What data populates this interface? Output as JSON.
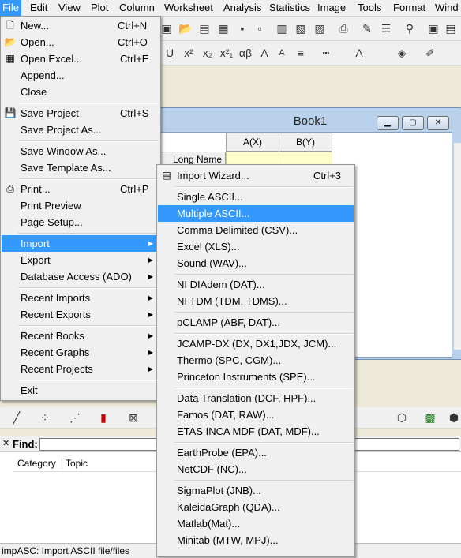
{
  "menubar": {
    "items": [
      "File",
      "Edit",
      "View",
      "Plot",
      "Column",
      "Worksheet",
      "Analysis",
      "Statistics",
      "Image",
      "Tools",
      "Format",
      "Wind"
    ]
  },
  "format_toolbar": {
    "superscript": "x²",
    "subscript": "x₂",
    "supsub": "x²₁",
    "greek": "αβ",
    "grow_font": "A",
    "shrink_font": "A"
  },
  "book": {
    "title": "Book1",
    "col_a": "A(X)",
    "col_b": "B(Y)",
    "row_long_name": "Long Name"
  },
  "file_menu": {
    "items": [
      {
        "label": "New...",
        "shortcut": "Ctrl+N",
        "icon": "new-icon"
      },
      {
        "label": "Open...",
        "shortcut": "Ctrl+O",
        "icon": "open-folder-icon"
      },
      {
        "label": "Open Excel...",
        "shortcut": "Ctrl+E",
        "icon": "excel-icon"
      },
      {
        "label": "Append...",
        "shortcut": ""
      },
      {
        "label": "Close",
        "shortcut": ""
      },
      {
        "label": "Save Project",
        "shortcut": "Ctrl+S",
        "icon": "save-icon"
      },
      {
        "label": "Save Project As...",
        "shortcut": ""
      },
      {
        "label": "Save Window As...",
        "shortcut": ""
      },
      {
        "label": "Save Template As...",
        "shortcut": ""
      },
      {
        "label": "Print...",
        "shortcut": "Ctrl+P",
        "icon": "print-icon"
      },
      {
        "label": "Print Preview",
        "shortcut": ""
      },
      {
        "label": "Page Setup...",
        "shortcut": ""
      },
      {
        "label": "Import",
        "shortcut": "",
        "submenu": true
      },
      {
        "label": "Export",
        "shortcut": "",
        "submenu": true
      },
      {
        "label": "Database Access (ADO)",
        "shortcut": "",
        "submenu": true
      },
      {
        "label": "Recent Imports",
        "shortcut": "",
        "submenu": true
      },
      {
        "label": "Recent Exports",
        "shortcut": "",
        "submenu": true
      },
      {
        "label": "Recent Books",
        "shortcut": "",
        "submenu": true
      },
      {
        "label": "Recent Graphs",
        "shortcut": "",
        "submenu": true
      },
      {
        "label": "Recent Projects",
        "shortcut": "",
        "submenu": true
      },
      {
        "label": "Exit",
        "shortcut": ""
      }
    ]
  },
  "import_menu": {
    "items": [
      {
        "label": "Import Wizard...",
        "shortcut": "Ctrl+3",
        "icon": "import-wizard-icon"
      },
      {
        "label": "Single ASCII..."
      },
      {
        "label": "Multiple ASCII..."
      },
      {
        "label": "Comma Delimited (CSV)..."
      },
      {
        "label": "Excel (XLS)..."
      },
      {
        "label": "Sound (WAV)..."
      },
      {
        "label": "NI DIAdem (DAT)..."
      },
      {
        "label": "NI TDM (TDM, TDMS)..."
      },
      {
        "label": "pCLAMP (ABF, DAT)..."
      },
      {
        "label": "JCAMP-DX (DX, DX1,JDX, JCM)..."
      },
      {
        "label": "Thermo (SPC, CGM)..."
      },
      {
        "label": "Princeton Instruments (SPE)..."
      },
      {
        "label": "Data Translation (DCF, HPF)..."
      },
      {
        "label": "Famos (DAT, RAW)..."
      },
      {
        "label": "ETAS INCA MDF (DAT, MDF)..."
      },
      {
        "label": "EarthProbe (EPA)..."
      },
      {
        "label": "NetCDF (NC)..."
      },
      {
        "label": "SigmaPlot (JNB)..."
      },
      {
        "label": "KaleidaGraph (QDA)..."
      },
      {
        "label": "Matlab(Mat)..."
      },
      {
        "label": "Minitab (MTW, MPJ)..."
      }
    ]
  },
  "find": {
    "label": "Find:"
  },
  "panel": {
    "col_category": "Category",
    "col_topic": "Topic"
  },
  "status": {
    "text": "impASC: Import ASCII file/files"
  },
  "colors": {
    "highlight": "#3399ff",
    "menu_bg": "#f0f0f0",
    "cell_yellow": "#ffffcc"
  }
}
